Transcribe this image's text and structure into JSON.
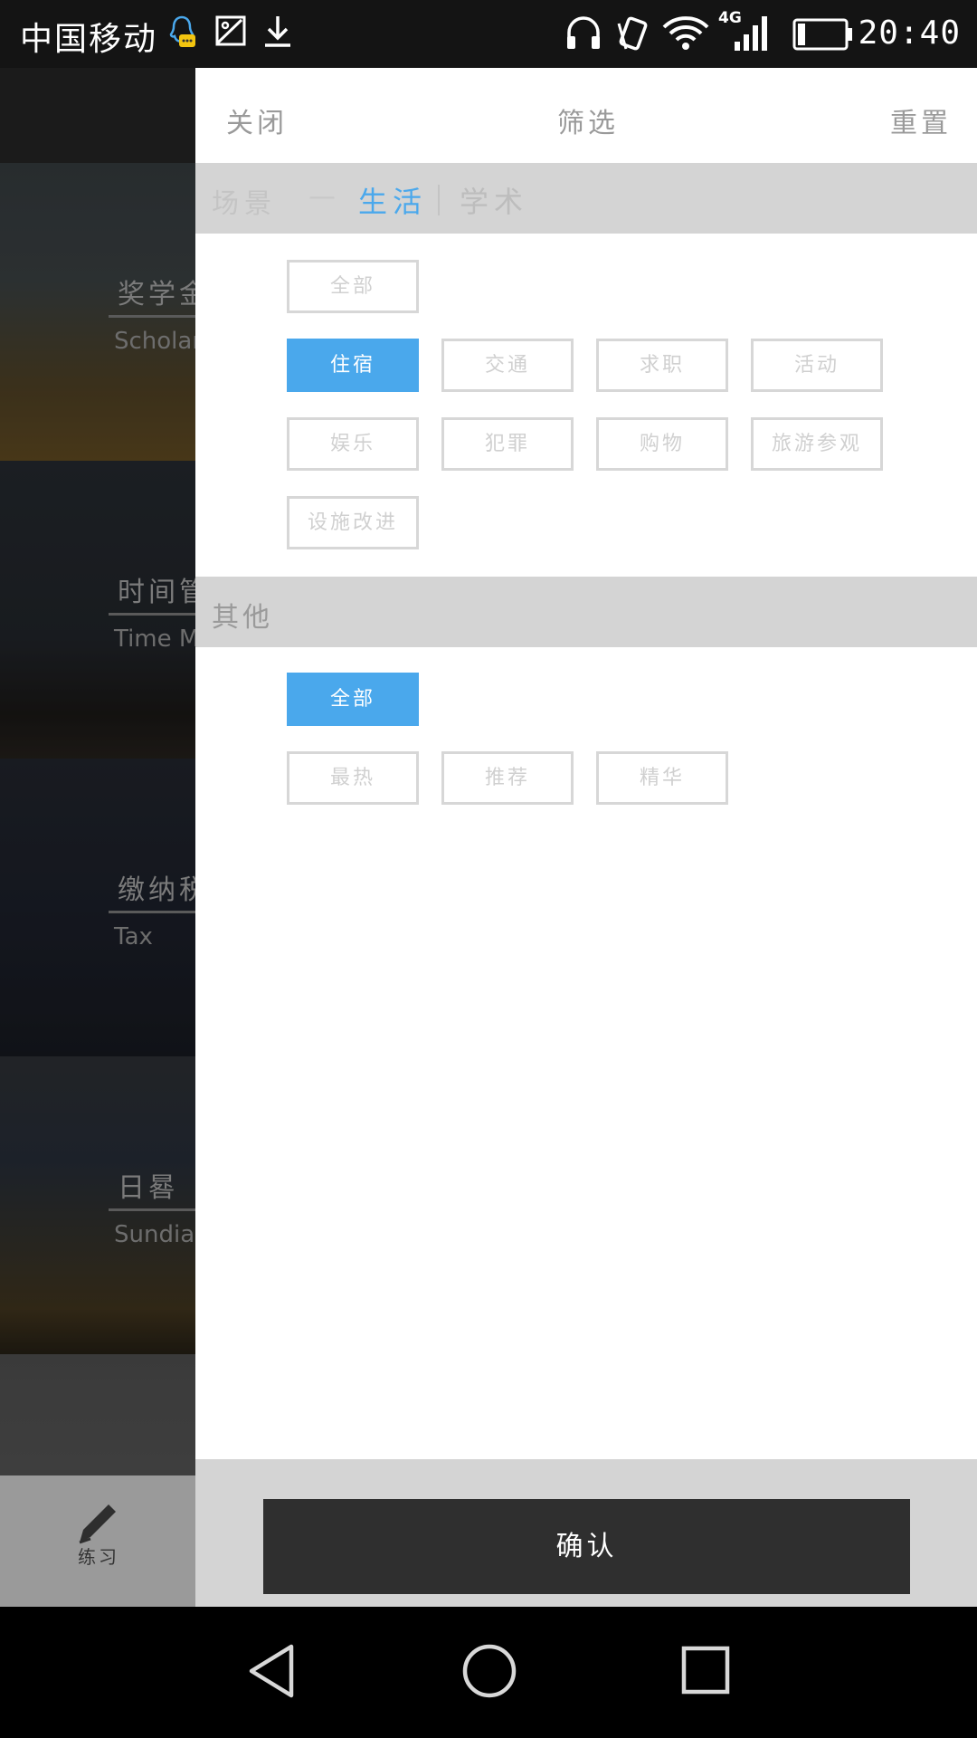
{
  "status_bar": {
    "carrier": "中国移动",
    "time": "20:40",
    "network": "4G",
    "icons": [
      "qq-icon",
      "image-icon",
      "download-icon",
      "headphones-icon",
      "vibrate-icon",
      "wifi-icon",
      "signal-icon",
      "battery-icon"
    ]
  },
  "background_list": {
    "cards": [
      {
        "title": "奖学金",
        "subtitle": "Scholarship"
      },
      {
        "title": "时间管理",
        "subtitle": "Time Management"
      },
      {
        "title": "缴纳税",
        "subtitle": "Tax"
      },
      {
        "title": "日晷",
        "subtitle": "Sundial"
      },
      {
        "title": "",
        "subtitle": ""
      }
    ],
    "bottom_tab": {
      "label": "练习",
      "icon": "pencil-icon"
    }
  },
  "drawer": {
    "header": {
      "close": "关闭",
      "title": "筛选",
      "reset": "重置"
    },
    "scene": {
      "label": "场景",
      "dash": "—",
      "options": [
        {
          "label": "生活",
          "active": true
        },
        {
          "label": "学术",
          "active": false
        }
      ],
      "tags": [
        {
          "label": "全部",
          "selected": false
        },
        {
          "label": "住宿",
          "selected": true
        },
        {
          "label": "交通",
          "selected": false
        },
        {
          "label": "求职",
          "selected": false
        },
        {
          "label": "活动",
          "selected": false
        },
        {
          "label": "娱乐",
          "selected": false
        },
        {
          "label": "犯罪",
          "selected": false
        },
        {
          "label": "购物",
          "selected": false
        },
        {
          "label": "旅游参观",
          "selected": false
        },
        {
          "label": "设施改进",
          "selected": false
        }
      ]
    },
    "other": {
      "label": "其他",
      "tags": [
        {
          "label": "全部",
          "selected": true
        },
        {
          "label": "最热",
          "selected": false
        },
        {
          "label": "推荐",
          "selected": false
        },
        {
          "label": "精华",
          "selected": false
        }
      ]
    },
    "confirm": "确认"
  },
  "colors": {
    "accent": "#4aa8ec",
    "confirm_bg": "#2f2f2f",
    "section_bg": "#d4d4d4"
  }
}
